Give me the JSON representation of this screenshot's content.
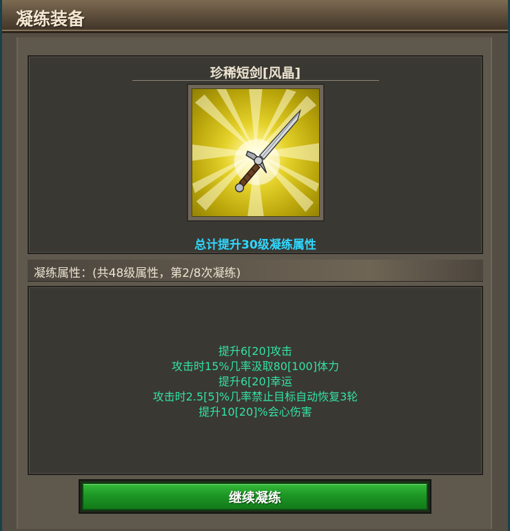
{
  "window": {
    "title": "凝练装备"
  },
  "item": {
    "name": "珍稀短剑[风晶]",
    "icon": "short-sword-icon",
    "total_bonus": "总计提升30级凝练属性"
  },
  "attributes": {
    "header": "凝练属性：(共48级属性，第2/8次凝练)",
    "lines": [
      "提升6[20]攻击",
      "攻击时15%几率汲取80[100]体力",
      "提升6[20]幸运",
      "攻击时2.5[5]%几率禁止目标自动恢复3轮",
      "提升10[20]%会心伤害"
    ]
  },
  "actions": {
    "continue_label": "继续凝练"
  },
  "colors": {
    "attribute_text": "#33e3a5",
    "total_bonus_text": "#2fd8ff",
    "button_green": "#1d9725"
  }
}
